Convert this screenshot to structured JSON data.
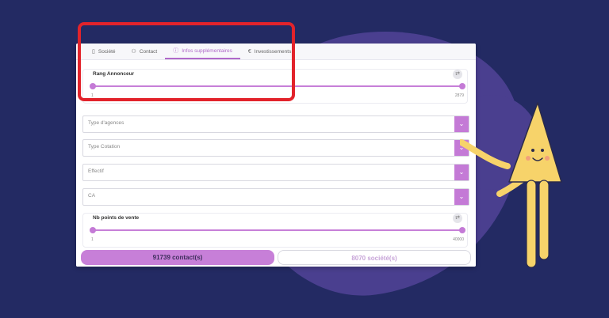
{
  "tabs": [
    {
      "icon": "building-icon",
      "label": "Société"
    },
    {
      "icon": "contact-icon",
      "label": "Contact"
    },
    {
      "icon": "info-icon",
      "label": "Infos supplémentaires",
      "active": true
    },
    {
      "icon": "euro-icon",
      "label": "Investissements"
    }
  ],
  "rang": {
    "title": "Rang Annonceur",
    "min": "1",
    "max": "2879"
  },
  "selects": [
    {
      "placeholder": "Type d'agences"
    },
    {
      "placeholder": "Type Cotation"
    },
    {
      "placeholder": "Effectif"
    },
    {
      "placeholder": "CA"
    }
  ],
  "points": {
    "title": "Nb points de vente",
    "min": "1",
    "max": "40000"
  },
  "footer": {
    "contacts_label": "91739 contact(s)",
    "societes_label": "8070 société(s)"
  },
  "colors": {
    "accent": "#c77fd8",
    "background": "#232a63",
    "highlight": "#e2232b"
  }
}
